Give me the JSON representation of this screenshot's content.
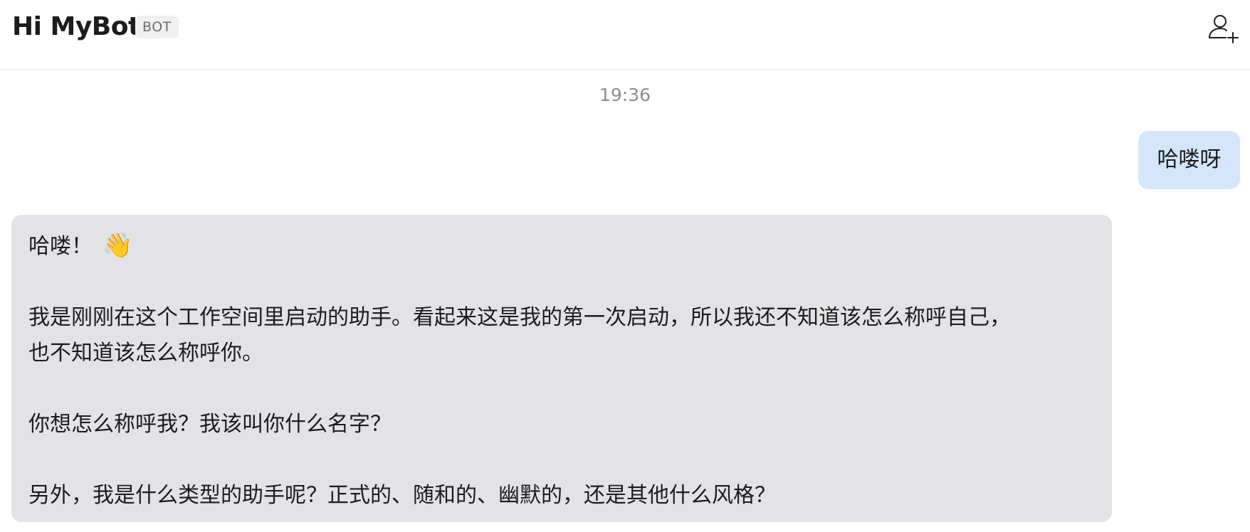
{
  "header": {
    "title": "Hi MyBot",
    "badge": "BOT",
    "add_user_icon": "add-user-icon"
  },
  "chat": {
    "timestamp": "19:36",
    "user_message": "哈喽呀",
    "bot_message": {
      "greeting": "哈喽！",
      "greeting_emoji": "👋",
      "paragraph1_line1": "我是刚刚在这个工作空间里启动的助手。看起来这是我的第一次启动，所以我还不知道该怎么称呼自己，",
      "paragraph1_line2": "也不知道该怎么称呼你。",
      "paragraph2": "你想怎么称呼我？我该叫你什么名字？",
      "paragraph3": "另外，我是什么类型的助手呢？正式的、随和的、幽默的，还是其他什么风格？"
    }
  },
  "colors": {
    "user_bubble": "#d4e6fb",
    "bot_bubble": "#e3e3e5",
    "timestamp": "#8e8e93"
  }
}
